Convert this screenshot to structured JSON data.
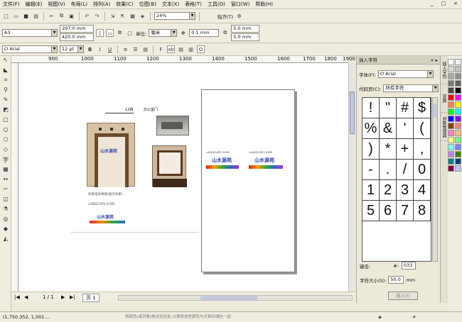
{
  "menu": {
    "items": [
      "文件(F)",
      "编辑(E)",
      "视图(V)",
      "布局(L)",
      "排列(A)",
      "效果(C)",
      "位图(B)",
      "文本(X)",
      "表格(T)",
      "工具(O)",
      "窗口(W)",
      "帮助(H)"
    ],
    "window_controls": [
      "_",
      "□",
      "×"
    ]
  },
  "standard_toolbar": {
    "zoom_value": "24%",
    "snap_label": "贴齐(T)"
  },
  "property_bar": {
    "page_size": "A3",
    "width": "297.0 mm",
    "height": "420.0 mm",
    "units_label": "单位:",
    "units_value": "毫米",
    "nudge": "0.1 mm",
    "dup_x": "5.0 mm",
    "dup_y": "5.0 mm"
  },
  "text_bar": {
    "font": "Arial",
    "size": "12 pt",
    "bold": "B",
    "italic": "I",
    "underline": "U"
  },
  "ruler": {
    "labels": [
      "900",
      "1000",
      "1100",
      "1200",
      "1300",
      "1400",
      "1500",
      "1600",
      "1700",
      "1800",
      "1900"
    ]
  },
  "canvas": {
    "dim_label": "12档",
    "photo_label": "办公室门",
    "caption": "形象墙效果图(展示效果)",
    "logo_text": "山水源苑",
    "logo_sub": "LANDSCAPE HOME"
  },
  "docker": {
    "title": "插入字符",
    "font_label": "字体(F):",
    "font_value": "Arial",
    "codepage_label": "代码页(C):",
    "codepage_value": "所有字符",
    "glyphs": [
      "!",
      "\"",
      "#",
      "$",
      "%",
      "&",
      "'",
      "(",
      ")",
      "*",
      "+",
      ",",
      "-",
      ".",
      "/",
      "0",
      "1",
      "2",
      "3",
      "4",
      "5",
      "6",
      "7",
      "8"
    ],
    "shortcut_label": "键击:",
    "shortcut_hash": "#:",
    "shortcut_code": "033",
    "char_size_label": "字符大小(S):",
    "char_size_value": "50.0",
    "char_size_unit": "mm",
    "insert_button": "插入(I)"
  },
  "right_tabs": [
    "插入字符",
    "变换",
    "对象管理器"
  ],
  "page_nav": {
    "current": "1 / 1",
    "page_tab": "页 1"
  },
  "status": {
    "coords": "(1,750.352, 1,001....",
    "hint": "将颜色(或对象)拖动至此处,以便将这些颜色与文档存储在一起"
  },
  "palette_colors": [
    "#ffffff",
    "#f0f0f0",
    "#d8d8d8",
    "#c0c0c0",
    "#a8a8a8",
    "#909090",
    "#787878",
    "#606060",
    "#484848",
    "#000000",
    "#ff0000",
    "#ff00ff",
    "#ff8040",
    "#ffff00",
    "#00ff00",
    "#00ffff",
    "#0000ff",
    "#8000ff",
    "#804000",
    "#ff8080",
    "#ff80c0",
    "#ffc080",
    "#ffff80",
    "#80ff80",
    "#80ffff",
    "#8080ff",
    "#c080ff",
    "#408000",
    "#008080",
    "#004080",
    "#800040",
    "#c0c0ff"
  ]
}
